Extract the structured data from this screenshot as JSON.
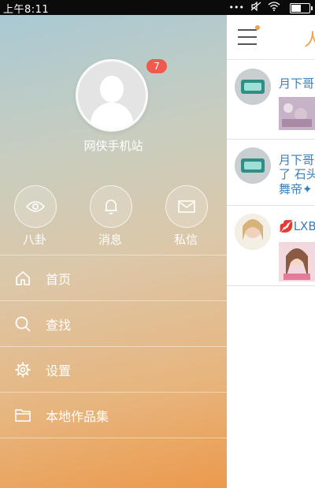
{
  "status_bar": {
    "time": "上午8:11",
    "icons": [
      "dots-icon",
      "mute-icon",
      "wifi-icon",
      "battery-icon"
    ]
  },
  "drawer": {
    "username": "网侠手机站",
    "badge_count": "7",
    "quick_actions": [
      {
        "label": "八卦",
        "icon": "eye-icon"
      },
      {
        "label": "消息",
        "icon": "bell-icon"
      },
      {
        "label": "私信",
        "icon": "mail-icon"
      }
    ],
    "menu": [
      {
        "label": "首页",
        "icon": "home-icon"
      },
      {
        "label": "查找",
        "icon": "search-icon"
      },
      {
        "label": "设置",
        "icon": "gear-icon"
      },
      {
        "label": "本地作品集",
        "icon": "folder-icon"
      }
    ],
    "colors": {
      "gradient_top": "#a9c9d3",
      "gradient_bottom": "#ec9a4c",
      "badge": "#f2594e"
    }
  },
  "content": {
    "tab_char": "人",
    "accent": "#f3a04a",
    "feed": [
      {
        "name": "月下哥"
      },
      {
        "name": "月下哥",
        "text_line1": "了 石头",
        "text_line2": "舞帝✦"
      },
      {
        "name": "LXB."
      }
    ]
  }
}
